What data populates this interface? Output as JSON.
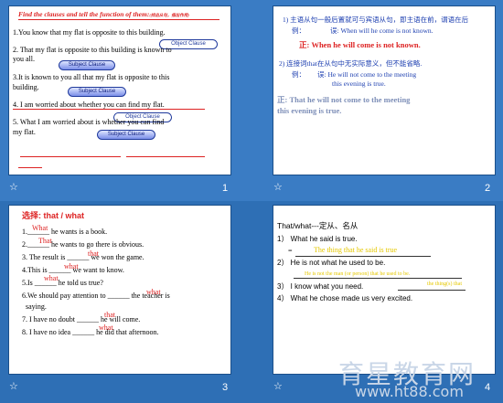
{
  "slide1": {
    "number": "1",
    "title": "Find the clauses and tell the function of them:",
    "title_suffix": "(找出从句，指出作用)",
    "line1": "1.You know that my flat is opposite to this building.",
    "pill1": "Object  Clause",
    "line2a": "2. That my flat is opposite to this building is known to",
    "line2b": "you all.",
    "pill2": "Subject  Clause",
    "line3a": "3.It is known to you all that my flat is opposite to this",
    "line3b": "building.",
    "pill3": "Subject  Clause",
    "line4": "4. I am worried about whether you can find my flat.",
    "pill4": "Object  Clause",
    "line5a": "5. What I am worried about is whether you can find",
    "line5b": "my flat.",
    "pill5": "Subject  Clause"
  },
  "slide2": {
    "number": "2",
    "rule1": "1) 主语从句一般后置就可与宾语从句，即主语在前，谓语在后",
    "ex1_label": "例：",
    "ex1_cn": "误: When will he come is not known.",
    "ex1_fix": "正: When he will come is not known.",
    "rule2": "2) 连接词that在从句中无实际意义，但不能省略.",
    "ex2_label": "例：",
    "ex2_cn_a": "误: He will not come to the meeting",
    "ex2_cn_b": "this evening is true.",
    "ex2_fix_a": "正: That he will not come to the meeting",
    "ex2_fix_b": "this evening is true."
  },
  "slide3": {
    "number": "3",
    "title": "选择: that / what",
    "items": [
      {
        "ans": "What",
        "text": "1.______ he wants is a book."
      },
      {
        "ans": "That",
        "text": "2.______ he wants to go there is obvious."
      },
      {
        "ans": "that",
        "text": "3. The result is ______ we won the game."
      },
      {
        "ans": "what",
        "text": "4.This is ______ we want to know."
      },
      {
        "ans": "what",
        "text": "5.Is ______ he told us true?"
      },
      {
        "ans": "what",
        "text": "6.We should pay attention to ______ the teacher is"
      },
      {
        "ans": "",
        "text": "saying."
      },
      {
        "ans": "that",
        "text": "7. I have no doubt ______ he will come."
      },
      {
        "ans": "what",
        "text": "8. I have no idea ______ he did that afternoon."
      }
    ]
  },
  "slide4": {
    "number": "4",
    "title": "That/what---定从、名从",
    "l1": "1） What he said is true.",
    "l1_eq": "=",
    "l1_ans": "The thing that he said is true",
    "l2": "2） He is not what he used to be.",
    "l2_ans": "He is not the man (or person) that he used to be.",
    "l3a": "3） I know what you need.",
    "l3_ans": "the thing(s) that",
    "l4": "4）  What he chose made us very excited."
  },
  "watermark": {
    "cn": "育星教育网",
    "url": "www.ht88.com"
  }
}
